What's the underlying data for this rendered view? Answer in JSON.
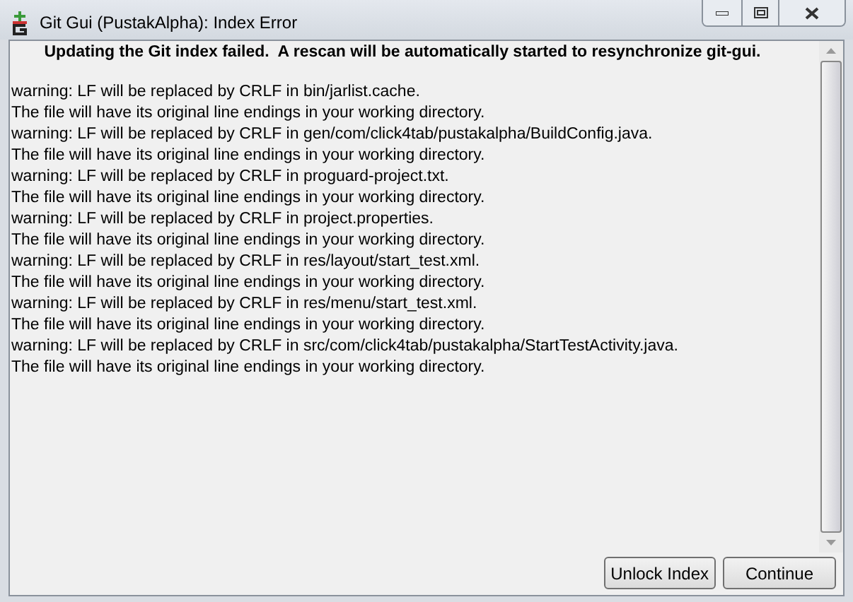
{
  "window": {
    "title": "Git Gui (PustakAlpha): Index Error"
  },
  "message": "Updating the Git index failed.  A rescan will be automatically started to resynchronize git-gui.",
  "log": [
    "warning: LF will be replaced by CRLF in bin/jarlist.cache.",
    "The file will have its original line endings in your working directory.",
    "warning: LF will be replaced by CRLF in gen/com/click4tab/pustakalpha/BuildConfig.java.",
    "The file will have its original line endings in your working directory.",
    "warning: LF will be replaced by CRLF in proguard-project.txt.",
    "The file will have its original line endings in your working directory.",
    "warning: LF will be replaced by CRLF in project.properties.",
    "The file will have its original line endings in your working directory.",
    "warning: LF will be replaced by CRLF in res/layout/start_test.xml.",
    "The file will have its original line endings in your working directory.",
    "warning: LF will be replaced by CRLF in res/menu/start_test.xml.",
    "The file will have its original line endings in your working directory.",
    "warning: LF will be replaced by CRLF in src/com/click4tab/pustakalpha/StartTestActivity.java.",
    "The file will have its original line endings in your working directory."
  ],
  "buttons": [
    "Unlock Index",
    "Continue"
  ]
}
